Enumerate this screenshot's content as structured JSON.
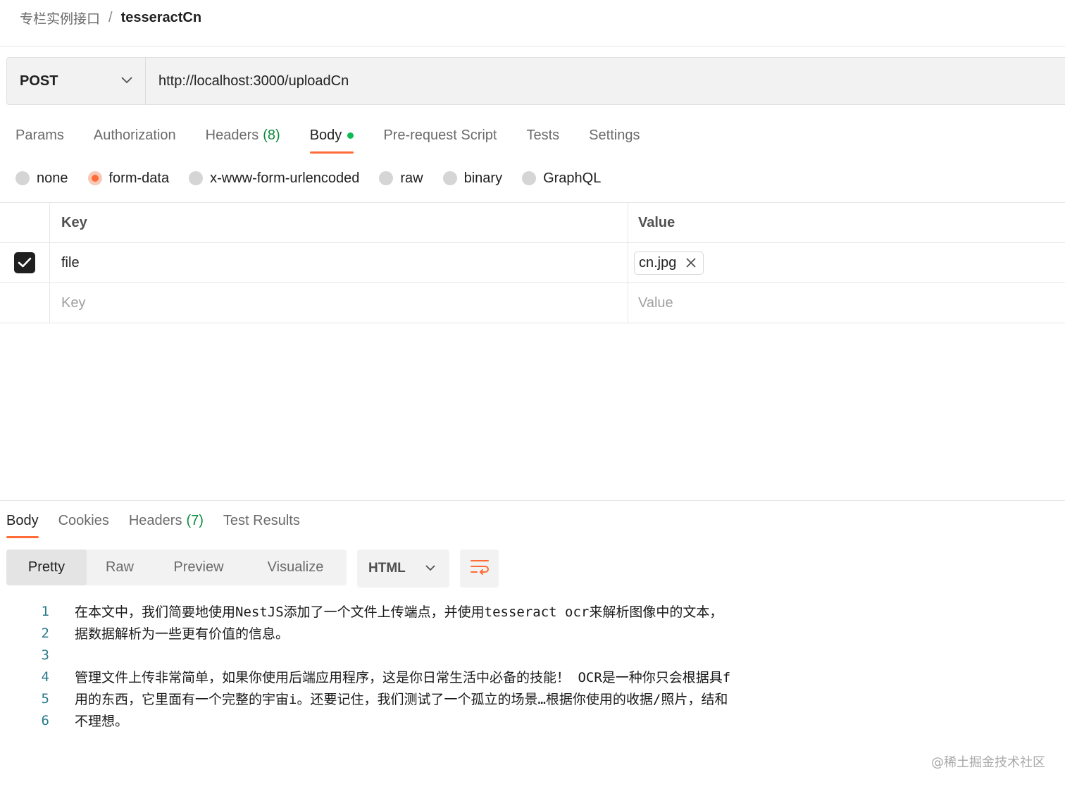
{
  "breadcrumb": {
    "parent": "专栏实例接口",
    "separator": "/",
    "current": "tesseractCn"
  },
  "request": {
    "method": "POST",
    "url": "http://localhost:3000/uploadCn"
  },
  "request_tabs": [
    {
      "label": "Params"
    },
    {
      "label": "Authorization"
    },
    {
      "label": "Headers",
      "count": "(8)"
    },
    {
      "label": "Body",
      "active": true
    },
    {
      "label": "Pre-request Script"
    },
    {
      "label": "Tests"
    },
    {
      "label": "Settings"
    }
  ],
  "body_types": [
    {
      "label": "none"
    },
    {
      "label": "form-data",
      "selected": true
    },
    {
      "label": "x-www-form-urlencoded"
    },
    {
      "label": "raw"
    },
    {
      "label": "binary"
    },
    {
      "label": "GraphQL"
    }
  ],
  "form_table": {
    "header": {
      "key": "Key",
      "value": "Value"
    },
    "rows": [
      {
        "checked": true,
        "key": "file",
        "value": "cn.jpg"
      }
    ],
    "placeholders": {
      "key": "Key",
      "value": "Value"
    }
  },
  "response_tabs": [
    {
      "label": "Body",
      "active": true
    },
    {
      "label": "Cookies"
    },
    {
      "label": "Headers",
      "count": "(7)"
    },
    {
      "label": "Test Results"
    }
  ],
  "view_modes": [
    {
      "label": "Pretty",
      "active": true
    },
    {
      "label": "Raw"
    },
    {
      "label": "Preview"
    },
    {
      "label": "Visualize"
    }
  ],
  "format": "HTML",
  "code_lines": [
    {
      "n": "1",
      "text": "在本文中，我们简要地使用NestJS添加了一个文件上传端点，并使用tesseract ocr来解析图像中的文本，"
    },
    {
      "n": "2",
      "text": "据数据解析为一些更有价值的信息。"
    },
    {
      "n": "3",
      "text": ""
    },
    {
      "n": "4",
      "text": "管理文件上传非常简单，如果你使用后端应用程序，这是你日常生活中必备的技能！ OCR是一种你只会根据具f"
    },
    {
      "n": "5",
      "text": "用的东西，它里面有一个完整的宇宙i。还要记住，我们测试了一个孤立的场景…根据你使用的收据/照片，结和"
    },
    {
      "n": "6",
      "text": "不理想。"
    }
  ],
  "watermark": "@稀土掘金技术社区",
  "colors": {
    "accent": "#ff6c37",
    "count_green": "#0b8a3c",
    "dot_green": "#0cbb52"
  }
}
